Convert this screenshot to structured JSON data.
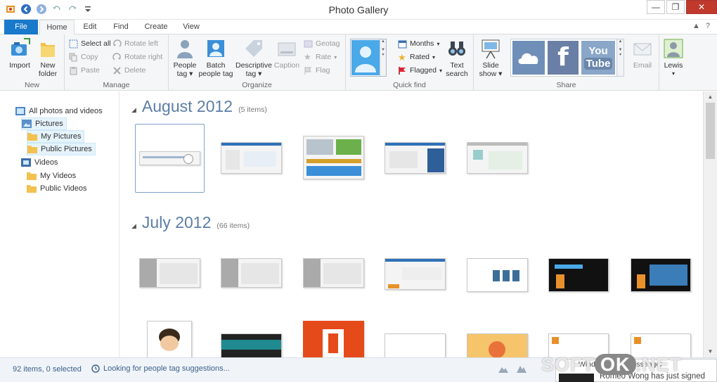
{
  "window": {
    "title": "Photo Gallery",
    "controls": {
      "minimize": "—",
      "restore": "❐",
      "close": "✕"
    }
  },
  "tabs": [
    {
      "label": "File"
    },
    {
      "label": "Home"
    },
    {
      "label": "Edit"
    },
    {
      "label": "Find"
    },
    {
      "label": "Create"
    },
    {
      "label": "View"
    }
  ],
  "ribbon": {
    "new": {
      "import": "Import",
      "new_folder_1": "New",
      "new_folder_2": "folder",
      "group": "New"
    },
    "manage": {
      "select_all": "Select all",
      "copy": "Copy",
      "paste": "Paste",
      "rotate_left": "Rotate left",
      "rotate_right": "Rotate right",
      "delete": "Delete",
      "group": "Manage"
    },
    "organize": {
      "people_tag_1": "People",
      "people_tag_2": "tag",
      "batch_1": "Batch",
      "batch_2": "people tag",
      "descriptive_1": "Descriptive",
      "descriptive_2": "tag",
      "caption": "Caption",
      "geotag": "Geotag",
      "rate": "Rate",
      "flag": "Flag",
      "group": "Organize"
    },
    "quickfind": {
      "months": "Months",
      "rated": "Rated",
      "flagged": "Flagged",
      "text_search_1": "Text",
      "text_search_2": "search",
      "group": "Quick find"
    },
    "share": {
      "slide_show_1": "Slide",
      "slide_show_2": "show",
      "email": "Email",
      "group": "Share"
    },
    "account": {
      "user": "Lewis"
    }
  },
  "nav": {
    "items": [
      {
        "label": "All photos and videos"
      },
      {
        "label": "Pictures"
      },
      {
        "label": "My Pictures"
      },
      {
        "label": "Public Pictures"
      },
      {
        "label": "Videos"
      },
      {
        "label": "My Videos"
      },
      {
        "label": "Public Videos"
      }
    ]
  },
  "sections": [
    {
      "month": "August 2012",
      "count": "(5 items)"
    },
    {
      "month": "July 2012",
      "count": "(66 items)"
    }
  ],
  "status": {
    "selection": "92 items, 0 selected",
    "message": "Looking for people tag suggestions..."
  },
  "watermark": {
    "left": "SOFT",
    "mid": "OK",
    "right": ".NET"
  },
  "toast": {
    "line1": "Windows Live Messenger",
    "line2": "Romeo Wong has just signed"
  },
  "colors": {
    "accent": "#1979ca",
    "heading": "#5b7ea8",
    "status_text": "#3b5f8a"
  }
}
